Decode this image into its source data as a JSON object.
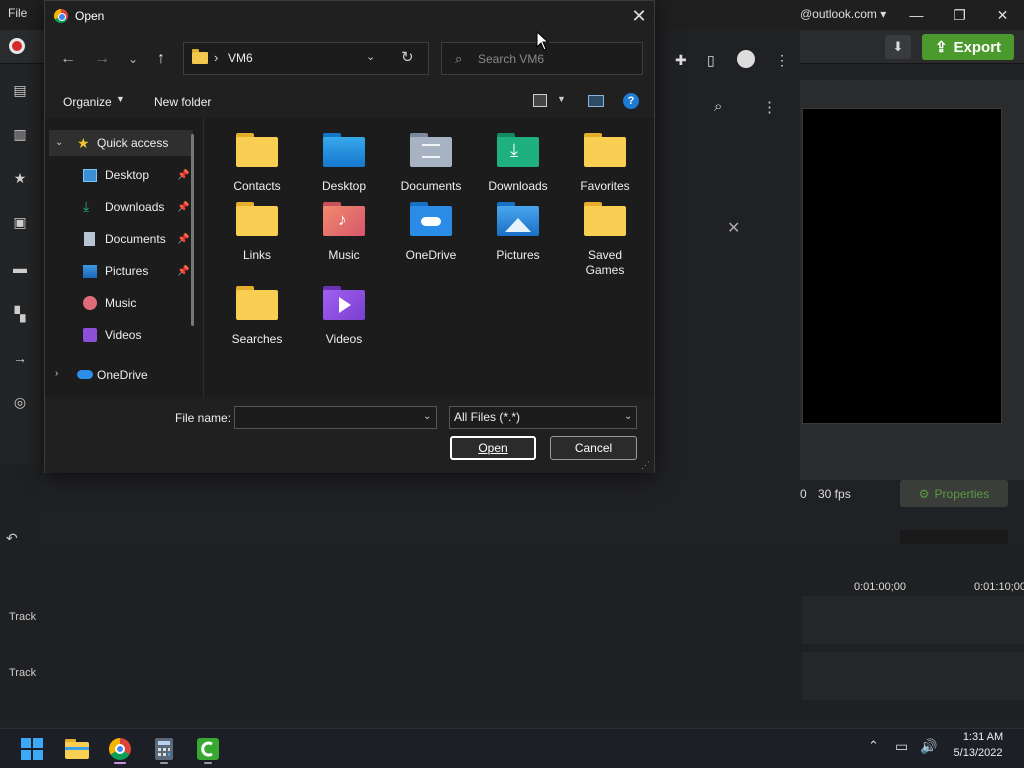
{
  "background_app": {
    "menu_file": "File",
    "account": "@outlook.com ▾",
    "export_label": "Export",
    "fps_prefix": "0",
    "fps": "30 fps",
    "properties_label": "Properties",
    "timeline": {
      "time_marks": [
        "0:01:00;00",
        "0:01:10;00"
      ],
      "tracks": [
        "Track",
        "Track"
      ]
    }
  },
  "dialog": {
    "title": "Open",
    "address": {
      "separator": "›",
      "path": "VM6"
    },
    "search": {
      "placeholder": "Search VM6",
      "value": ""
    },
    "commandbar": {
      "organize": "Organize",
      "new_folder": "New folder",
      "help": "?"
    },
    "nav_pane": {
      "quick_access": "Quick access",
      "items": [
        {
          "label": "Desktop",
          "icon": "desktop-icon",
          "pinned": true
        },
        {
          "label": "Downloads",
          "icon": "downloads-icon",
          "pinned": true
        },
        {
          "label": "Documents",
          "icon": "documents-icon",
          "pinned": true
        },
        {
          "label": "Pictures",
          "icon": "pictures-icon",
          "pinned": true
        },
        {
          "label": "Music",
          "icon": "music-icon",
          "pinned": false
        },
        {
          "label": "Videos",
          "icon": "videos-icon",
          "pinned": false
        }
      ],
      "onedrive": "OneDrive"
    },
    "files": [
      {
        "label": "Contacts",
        "icon": "folder-icon"
      },
      {
        "label": "Desktop",
        "icon": "desktop-folder-icon"
      },
      {
        "label": "Documents",
        "icon": "documents-folder-icon"
      },
      {
        "label": "Downloads",
        "icon": "downloads-folder-icon"
      },
      {
        "label": "Favorites",
        "icon": "folder-icon"
      },
      {
        "label": "Links",
        "icon": "folder-icon"
      },
      {
        "label": "Music",
        "icon": "music-folder-icon"
      },
      {
        "label": "OneDrive",
        "icon": "onedrive-folder-icon"
      },
      {
        "label": "Pictures",
        "icon": "pictures-folder-icon"
      },
      {
        "label": "Saved Games",
        "icon": "folder-icon"
      },
      {
        "label": "Searches",
        "icon": "folder-icon"
      },
      {
        "label": "Videos",
        "icon": "videos-folder-icon"
      }
    ],
    "bottom": {
      "file_name_label": "File name:",
      "file_name_value": "",
      "file_type": "All Files (*.*)",
      "open_label": "Open",
      "cancel_label": "Cancel"
    }
  },
  "taskbar": {
    "apps": [
      "start",
      "file-explorer",
      "chrome",
      "calculator",
      "camtasia"
    ],
    "time": "1:31 AM",
    "date": "5/13/2022"
  },
  "colors": {
    "folder_yellow": "#f3c74b",
    "export_green": "#4a9a2e",
    "help_blue": "#1f7ad6"
  }
}
